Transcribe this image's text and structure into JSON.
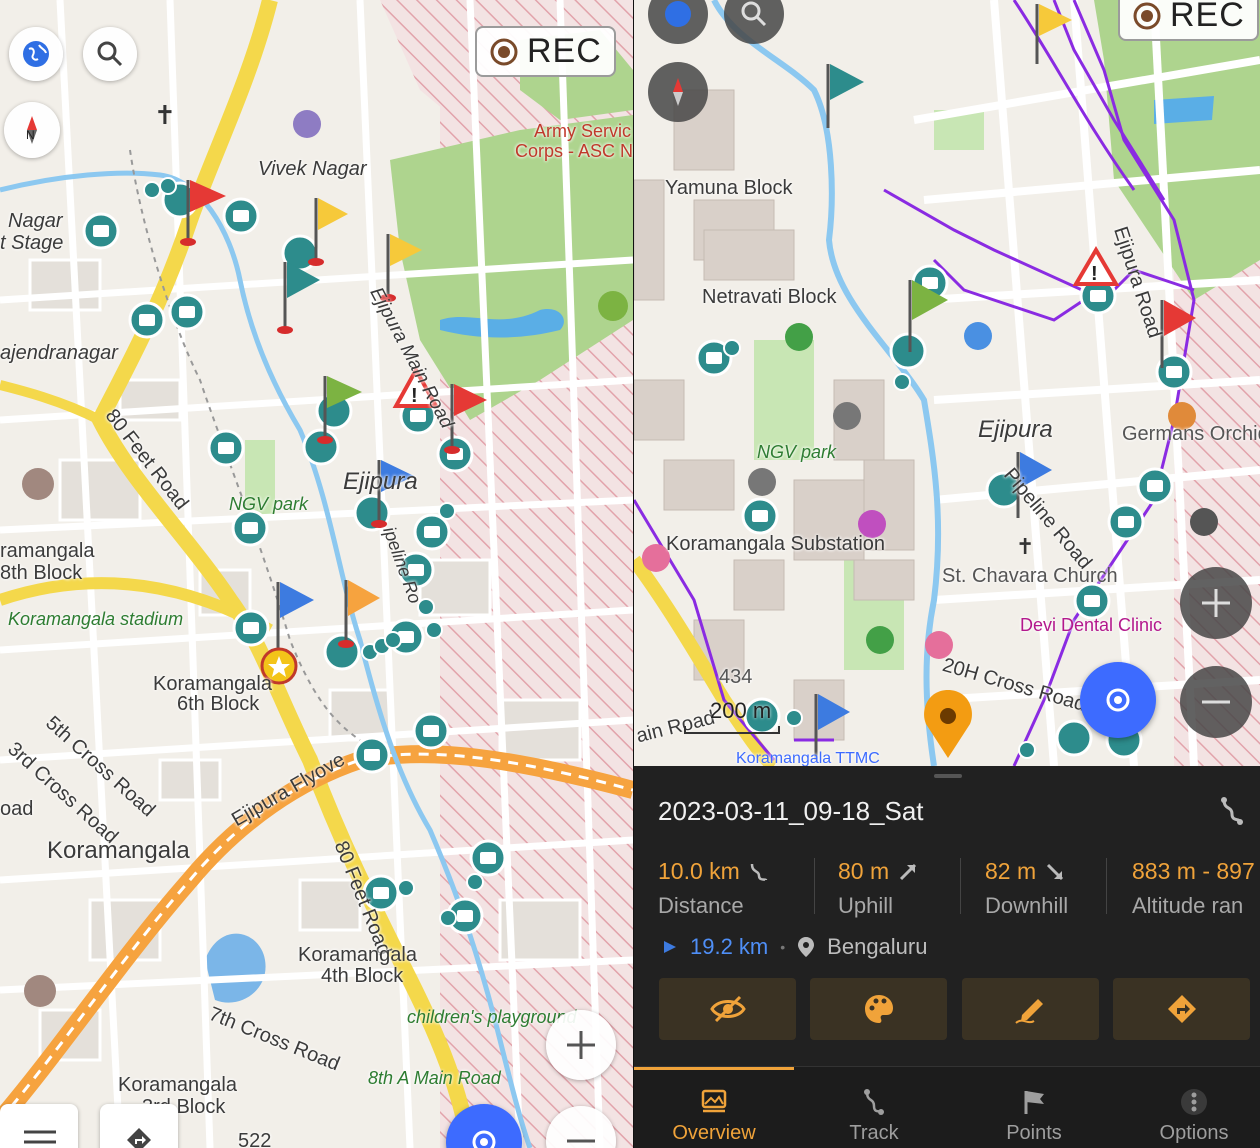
{
  "left_map": {
    "rec_label": "REC",
    "labels": {
      "vivek_nagar": "Vivek Nagar",
      "army_service_1": "Army Servic",
      "army_service_2": "Corps - ASC N",
      "nagar_stage_1": "Nagar",
      "nagar_stage_2": "t Stage",
      "rajendranagar": "ajendranagar",
      "ejipura_main_road": "Ejipura Main Road",
      "eighty_feet_road": "80 Feet Road",
      "ngv_park": "NGV park",
      "ejipura": "Ejipura",
      "koramangala_8th_1": "ramangala",
      "koramangala_8th_2": "8th Block",
      "koramangala_stadium": "Koramangala stadium",
      "koramangala_6th_1": "Koramangala",
      "koramangala_6th_2": "6th Block",
      "fifth_cross": "5th Cross Road",
      "third_cross": "3rd Cross Road",
      "oad": "oad",
      "koramangala": "Koramangala",
      "ejipura_flyover": "Ejipura Flyove",
      "eighty_feet_road_2": "80 Feet Road",
      "koramangala_4th_1": "Koramangala",
      "koramangala_4th_2": "4th Block",
      "seventh_cross": "7th Cross Road",
      "childrens_playground": "children's playground",
      "eighth_a_main": "8th A Main Road",
      "koramangala_3rd_1": "Koramangala",
      "koramangala_3rd_2": "3rd Block",
      "pipeline_fragment": "ipeline Ro",
      "num_522": "522"
    }
  },
  "right_map": {
    "rec_label": "REC",
    "scale_label": "200 m",
    "labels": {
      "yamuna_block": "Yamuna Block",
      "netravati_block": "Netravati Block",
      "ngv_park": "NGV park",
      "ejipura": "Ejipura",
      "germans_orchid": "Germans Orchid",
      "pipeline_road": "Pipeline Road",
      "koramangala_substation": "Koramangala Substation",
      "st_chavara": "St. Chavara Church",
      "devi_dental": "Devi Dental Clinic",
      "twentyh_cross": "20H Cross Road",
      "num_434": "434",
      "main_road_fragment": "ain Road",
      "ejipura_road": "Ejipura Road",
      "koramangala_ttmc": "Koramangala TTMC"
    }
  },
  "sheet": {
    "title": "2023-03-11_09-18_Sat",
    "stats": [
      {
        "value": "10.0 km",
        "label": "Distance",
        "icon": "route-icon"
      },
      {
        "value": "80 m",
        "label": "Uphill",
        "icon": "uphill-icon"
      },
      {
        "value": "82 m",
        "label": "Downhill",
        "icon": "downhill-icon"
      },
      {
        "value": "883 m - 897",
        "label": "Altitude ran",
        "icon": ""
      }
    ],
    "distance_to": "19.2 km",
    "separator": "•",
    "location": "Bengaluru",
    "actions": [
      "hide-icon",
      "palette-icon",
      "edit-icon",
      "navigate-icon"
    ],
    "tabs": [
      {
        "label": "Overview",
        "icon": "overview-icon",
        "active": true
      },
      {
        "label": "Track",
        "icon": "track-icon",
        "active": false
      },
      {
        "label": "Points",
        "icon": "flag-icon",
        "active": false
      },
      {
        "label": "Options",
        "icon": "more-icon",
        "active": false
      }
    ]
  },
  "colors": {
    "accent": "#f0a33a",
    "map_blue_button": "#3d6bff",
    "marker_teal": "#2d8c8c",
    "track_purple": "#8a2be2"
  }
}
